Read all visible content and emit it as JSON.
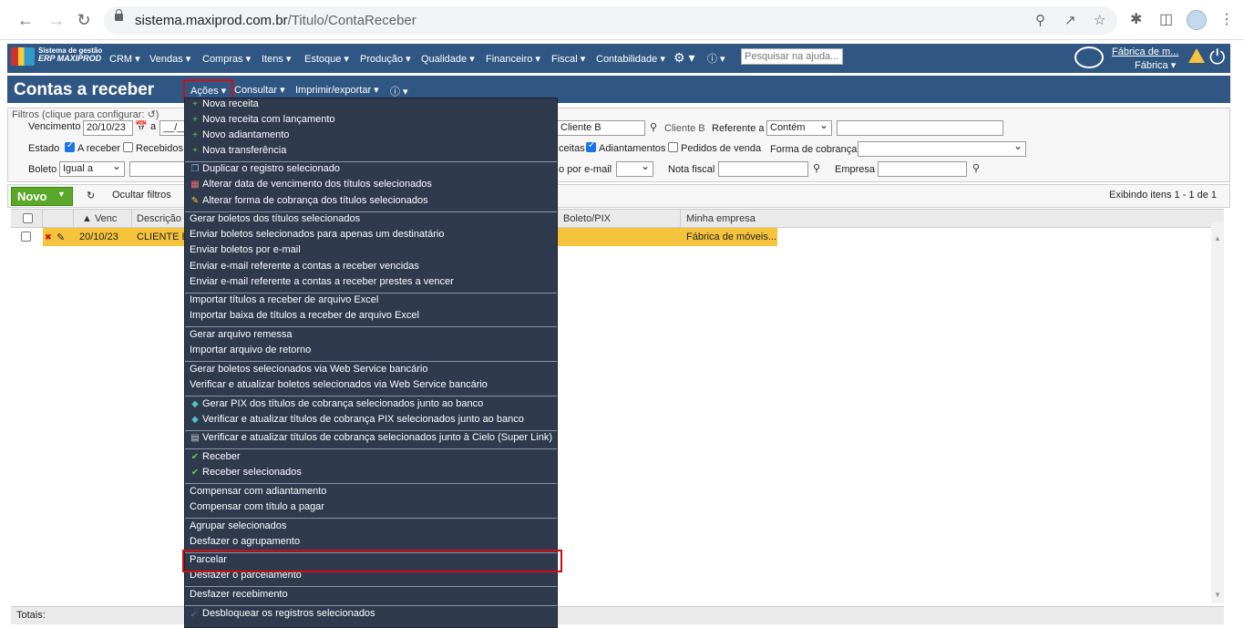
{
  "browser": {
    "url_host": "sistema.maxiprod.com.br",
    "url_path": "/Titulo/ContaReceber"
  },
  "topnav": {
    "logo_line1": "Sistema de gestão",
    "logo_line2": "ERP MAXIPROD",
    "items": [
      "CRM",
      "Vendas",
      "Compras",
      "Itens",
      "Estoque",
      "Produção",
      "Qualidade",
      "Financeiro",
      "Fiscal",
      "Contabilidade"
    ],
    "help_placeholder": "Pesquisar na ajuda...",
    "company_name": "Fábrica de m...",
    "company_sub": "Fábrica"
  },
  "titlebar": {
    "title": "Contas a receber",
    "acoes": "Ações",
    "consultar": "Consultar",
    "imprimir": "Imprimir/exportar"
  },
  "filters": {
    "header": "Filtros (clique para configurar:",
    "vencimento_label": "Vencimento",
    "vencimento_from": "20/10/23",
    "a_label": "a",
    "a_value": "__/__",
    "cliente_value": "Cliente B",
    "cliente_lookup": "Cliente B",
    "referente_label": "Referente a",
    "referente_value": "Contém",
    "estado_label": "Estado",
    "areceber": "A receber",
    "recebidos": "Recebidos",
    "ceitas": "ceitas",
    "adiantamentos": "Adiantamentos",
    "pedidos": "Pedidos de venda",
    "forma_label": "Forma de cobrança",
    "boleto_label": "Boleto",
    "boleto_value": "Igual a",
    "email_label": "o por e-mail",
    "nota_label": "Nota fiscal",
    "empresa_label": "Empresa"
  },
  "toolbar": {
    "novo": "Novo",
    "ocultar": "Ocultar filtros",
    "exibindo": "Exibindo itens 1 - 1 de 1"
  },
  "grid": {
    "headers": [
      "Venc",
      "Descrição",
      "Boleto/PIX",
      "Minha empresa"
    ],
    "row": {
      "venc": "20/10/23",
      "desc": "CLIENTE B",
      "empresa": "Fábrica de móveis..."
    },
    "totais": "Totais:"
  },
  "menu": [
    "Nova receita",
    "Nova receita com lançamento",
    "Novo adiantamento",
    "Nova transferência",
    "Duplicar o registro selecionado",
    "Alterar data de vencimento dos títulos selecionados",
    "Alterar forma de cobrança dos títulos selecionados",
    "Gerar boletos dos títulos selecionados",
    "Enviar boletos selecionados para apenas um destinatário",
    "Enviar boletos por e-mail",
    "Enviar e-mail referente a contas a receber vencidas",
    "Enviar e-mail referente a contas a receber prestes a vencer",
    "Importar títulos a receber de arquivo Excel",
    "Importar baixa de títulos a receber de arquivo Excel",
    "Gerar arquivo remessa",
    "Importar arquivo de retorno",
    "Gerar boletos selecionados via Web Service bancário",
    "Verificar e atualizar boletos selecionados via Web Service bancário",
    "Gerar PIX dos títulos de cobrança selecionados junto ao banco",
    "Verificar e atualizar títulos de cobrança PIX selecionados junto ao banco",
    "Verificar e atualizar títulos de cobrança selecionados junto à Cielo (Super Link)",
    "Receber",
    "Receber selecionados",
    "Compensar com adiantamento",
    "Compensar com título a pagar",
    "Agrupar selecionados",
    "Desfazer o agrupamento",
    "Parcelar",
    "Desfazer o parcelamento",
    "Desfazer recebimento",
    "Desbloquear os registros selecionados"
  ]
}
